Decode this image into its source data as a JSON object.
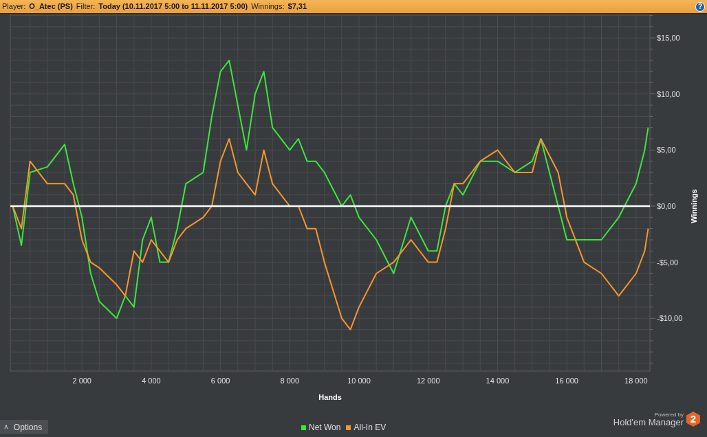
{
  "header": [
    {
      "label": "Player:",
      "value": "O_Atec (PS)"
    },
    {
      "label": "Filter:",
      "value": "Today (10.11.2017 5:00 to 11.11.2017 5:00)"
    },
    {
      "label": "Winnings:",
      "value": "$7,31"
    }
  ],
  "help": "?",
  "chart_data": {
    "type": "line",
    "xlabel": "Hands",
    "ylabel": "Winnings",
    "x": [
      0,
      250,
      500,
      1000,
      1500,
      1750,
      2000,
      2250,
      2500,
      3000,
      3250,
      3500,
      3750,
      4000,
      4250,
      4500,
      4750,
      5000,
      5500,
      5750,
      6000,
      6250,
      6500,
      6750,
      7000,
      7250,
      7500,
      8000,
      8250,
      8500,
      8750,
      9000,
      9500,
      9750,
      10000,
      10500,
      11000,
      11500,
      12000,
      12250,
      12500,
      12750,
      13000,
      13500,
      14000,
      14500,
      15000,
      15250,
      15750,
      16000,
      16500,
      17000,
      17500,
      18000,
      18250,
      18350
    ],
    "series": [
      {
        "name": "Net Won",
        "color": "#3ce63c",
        "values": [
          0,
          -3.5,
          3,
          3.5,
          5.5,
          2,
          -1,
          -6,
          -8.5,
          -10,
          -8,
          -9,
          -3,
          -1,
          -5,
          -5,
          -2,
          2,
          3,
          8,
          12,
          13,
          9,
          5,
          10,
          12,
          7,
          5,
          6,
          4,
          4,
          3,
          0,
          1,
          -1,
          -3,
          -6,
          -1,
          -4,
          -4,
          0,
          2,
          1,
          4,
          4,
          3,
          4,
          6,
          0,
          -3,
          -3,
          -3,
          -1,
          2,
          5,
          7
        ]
      },
      {
        "name": "All-In EV",
        "color": "#f7962d",
        "values": [
          0,
          -2,
          4,
          2,
          2,
          1,
          -3,
          -5,
          -5.5,
          -7,
          -8,
          -4,
          -5,
          -3,
          -4,
          -5,
          -3,
          -2,
          -1,
          0,
          4,
          6,
          3,
          2,
          1,
          5,
          2,
          0,
          0,
          -2,
          -2,
          -5,
          -10,
          -11,
          -9,
          -6,
          -5,
          -3,
          -5,
          -5,
          -2,
          2,
          2,
          4,
          5,
          3,
          3,
          6,
          3,
          -1,
          -5,
          -6,
          -8,
          -6,
          -4,
          -2
        ]
      }
    ],
    "xlim": [
      -70,
      18400
    ],
    "grid": true,
    "ylim": [
      -14.7,
      17.15
    ],
    "xticks": [
      {
        "value": 2000,
        "label": "2 000"
      },
      {
        "value": 4000,
        "label": "4 000"
      },
      {
        "value": 6000,
        "label": "6 000"
      },
      {
        "value": 8000,
        "label": "8 000"
      },
      {
        "value": 10000,
        "label": "10 000"
      },
      {
        "value": 12000,
        "label": "12 000"
      },
      {
        "value": 14000,
        "label": "14 000"
      },
      {
        "value": 16000,
        "label": "16 000"
      },
      {
        "value": 18000,
        "label": "18 000"
      }
    ],
    "yticks": [
      {
        "value": 15,
        "label": "$15,00"
      },
      {
        "value": 10,
        "label": "$10,00"
      },
      {
        "value": 5,
        "label": "$5,00"
      },
      {
        "value": 0,
        "label": "$0,00"
      },
      {
        "value": -5,
        "label": "-$5,00"
      },
      {
        "value": -10,
        "label": "-$10,00"
      }
    ]
  },
  "options_button": {
    "icon": "˄",
    "label": "Options"
  },
  "logo": {
    "caption": "Powered by",
    "name": "Hold'em Manager",
    "badge": "2"
  }
}
